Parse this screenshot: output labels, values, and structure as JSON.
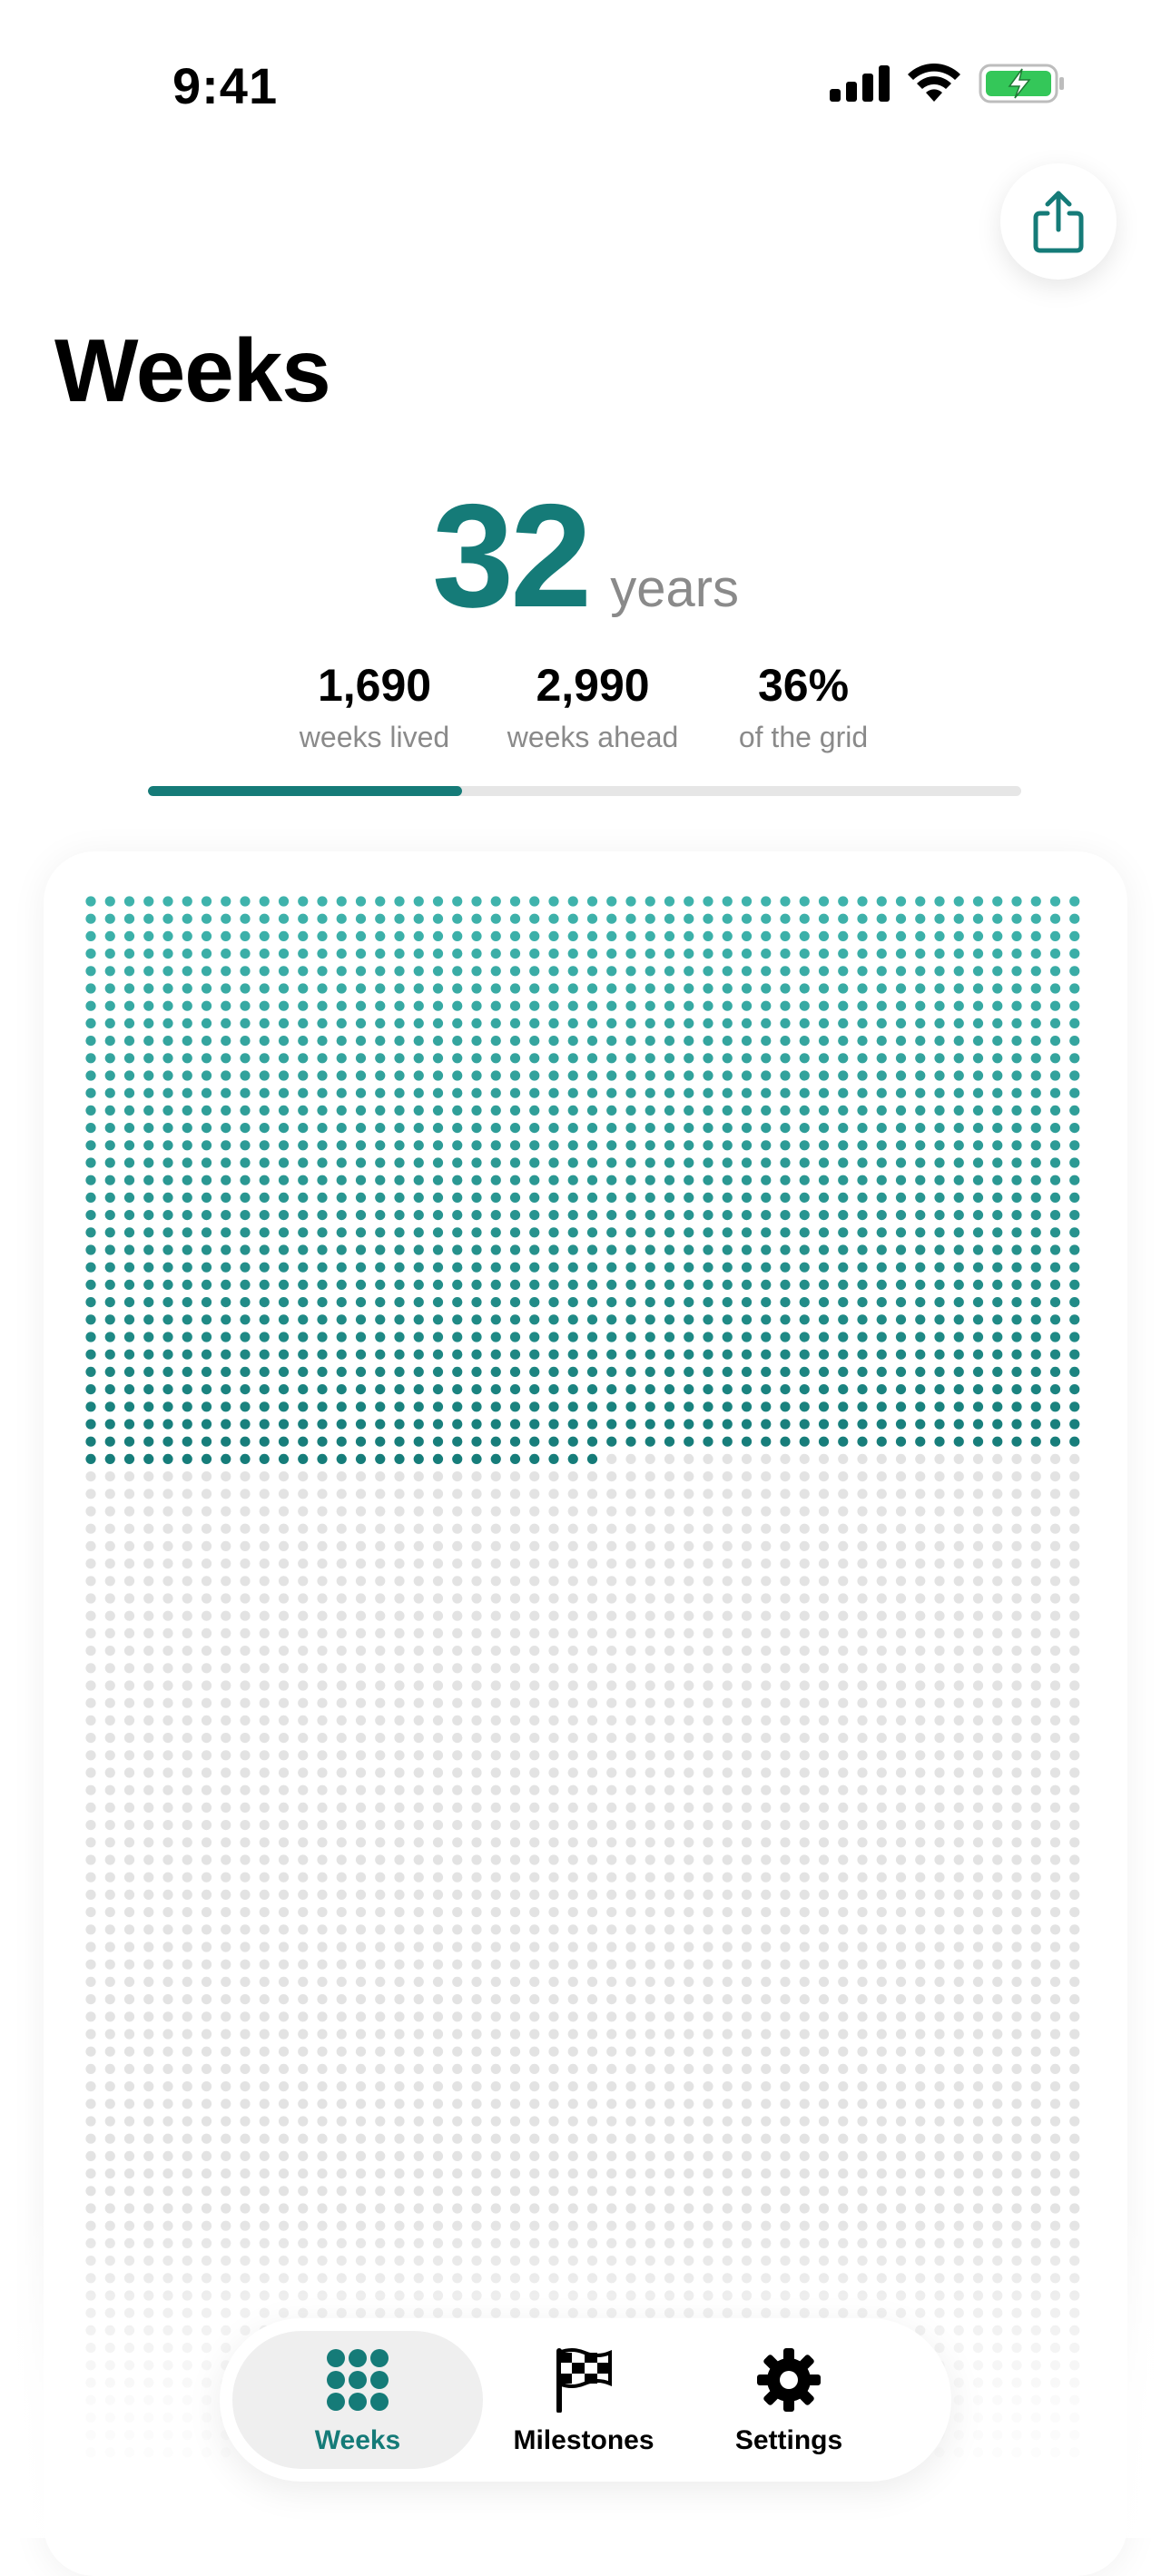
{
  "status_bar": {
    "time": "9:41"
  },
  "header": {
    "title": "Weeks",
    "share_icon": "share-icon"
  },
  "summary": {
    "age": "32",
    "age_unit": "years",
    "weeks_lived": "1,690",
    "weeks_lived_label": "weeks lived",
    "weeks_ahead": "2,990",
    "weeks_ahead_label": "weeks ahead",
    "grid_percent": "36%",
    "grid_percent_label": "of the grid",
    "progress_fraction": 0.36
  },
  "grid": {
    "columns": 52,
    "rows": 90,
    "weeks_lived": 1690,
    "lived_color": "#3fb3ac",
    "lived_color_end": "#157b78",
    "current_color": "#157b78",
    "remaining_color": "#e3e3e3"
  },
  "tab_bar": {
    "tabs": [
      {
        "label": "Weeks",
        "icon": "grid-dots-icon",
        "selected": true
      },
      {
        "label": "Milestones",
        "icon": "checkered-flag-icon",
        "selected": false
      },
      {
        "label": "Settings",
        "icon": "gear-icon",
        "selected": false
      }
    ]
  },
  "colors": {
    "accent": "#157b78",
    "secondary_text": "#8a8a8a"
  }
}
